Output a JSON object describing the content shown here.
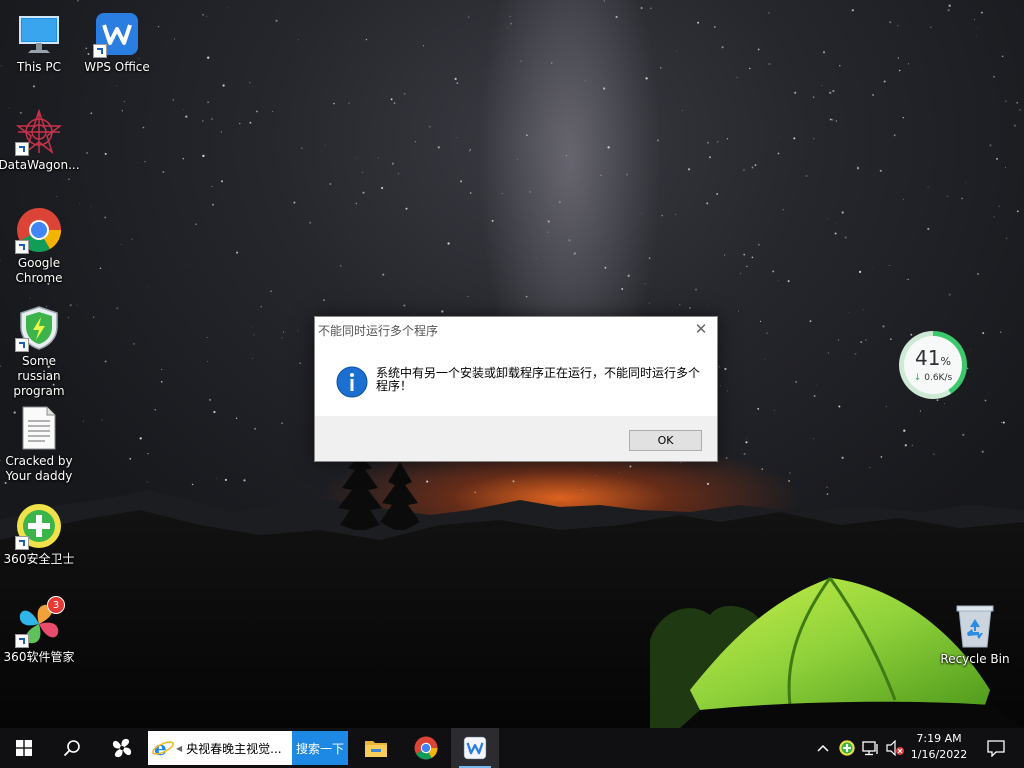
{
  "desktop": {
    "icons": [
      {
        "label": "This PC"
      },
      {
        "label": "WPS Office"
      },
      {
        "label": "DataWagon..."
      },
      {
        "label": "Google Chrome"
      },
      {
        "label": "Some russian program"
      },
      {
        "label": "Cracked by Your daddy"
      },
      {
        "label": "360安全卫士"
      },
      {
        "label": "360软件管家",
        "badge": "3"
      },
      {
        "label": "Recycle Bin"
      }
    ]
  },
  "net_widget": {
    "percent": "41",
    "percent_unit": "%",
    "speed": "0.6K/s"
  },
  "dialog": {
    "title": "不能同时运行多个程序",
    "message": "系统中有另一个安装或卸载程序正在运行，不能同时运行多个程序！",
    "ok_label": "OK"
  },
  "taskbar": {
    "search_text": "央视春晚主视觉...",
    "search_button": "搜索一下",
    "time": "7:19 AM",
    "date": "1/16/2022"
  },
  "colors": {
    "taskbar_bg": "#101012",
    "search_button": "#1e88e5",
    "info_icon": "#1b6fd1",
    "tent_green": "#8fd13a",
    "widget_ring": "#3cc96d"
  }
}
